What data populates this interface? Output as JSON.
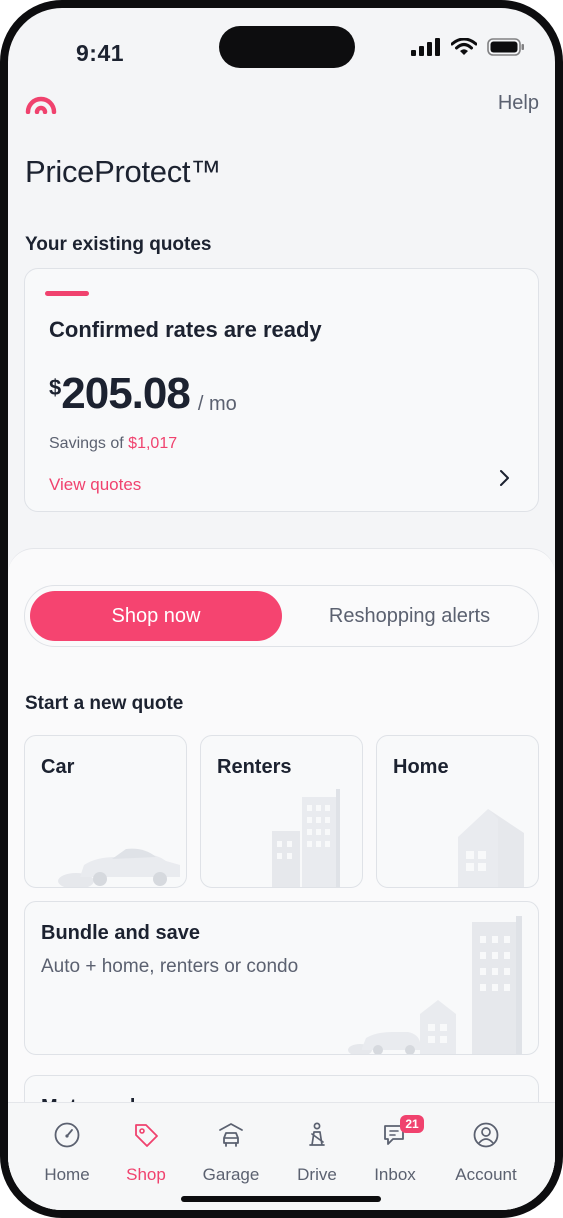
{
  "status_bar": {
    "time": "9:41"
  },
  "header": {
    "help_label": "Help",
    "title": "PriceProtect™"
  },
  "existing_quotes": {
    "section_label": "Your existing quotes",
    "card": {
      "heading": "Confirmed rates are ready",
      "currency_symbol": "$",
      "price": "205.08",
      "unit": "/ mo",
      "savings_prefix": "Savings of",
      "savings_amount": "$1,017",
      "link_label": "View quotes"
    }
  },
  "tabs_toggle": {
    "active": "Shop now",
    "inactive": "Reshopping alerts"
  },
  "new_quote": {
    "section_label": "Start a new quote",
    "tiles": [
      {
        "label": "Car"
      },
      {
        "label": "Renters"
      },
      {
        "label": "Home"
      }
    ],
    "bundle": {
      "label": "Bundle and save",
      "subtitle": "Auto + home, renters or condo"
    },
    "motorcycle": {
      "label": "Motorcycle"
    }
  },
  "bottom_nav": {
    "items": [
      {
        "label": "Home",
        "icon": "gauge-icon"
      },
      {
        "label": "Shop",
        "icon": "tag-icon",
        "active": true
      },
      {
        "label": "Garage",
        "icon": "garage-icon"
      },
      {
        "label": "Drive",
        "icon": "seatbelt-icon"
      },
      {
        "label": "Inbox",
        "icon": "chat-icon",
        "badge": "21"
      },
      {
        "label": "Account",
        "icon": "user-icon"
      }
    ]
  },
  "colors": {
    "accent": "#f0426e",
    "text": "#1c2230",
    "muted": "#5b6170"
  }
}
